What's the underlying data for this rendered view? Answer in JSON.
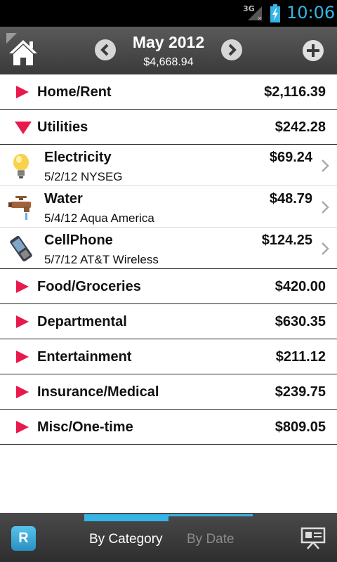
{
  "status_bar": {
    "network": "3G",
    "time": "10:06",
    "battery_icon": "battery-charging-icon",
    "signal_icon": "signal-no-data-icon",
    "time_color": "#33b5e5"
  },
  "header": {
    "title": "May 2012",
    "total": "$4,668.94",
    "home_icon": "home-icon",
    "prev_icon": "chevron-left-icon",
    "next_icon": "chevron-right-icon",
    "add_icon": "plus-icon"
  },
  "categories": [
    {
      "name": "Home/Rent",
      "amount": "$2,116.39",
      "expanded": false
    },
    {
      "name": "Utilities",
      "amount": "$242.28",
      "expanded": true,
      "items": [
        {
          "name": "Electricity",
          "detail": "5/2/12 NYSEG",
          "amount": "$69.24",
          "icon": "lightbulb-icon"
        },
        {
          "name": "Water",
          "detail": "5/4/12 Aqua America",
          "amount": "$48.79",
          "icon": "faucet-icon"
        },
        {
          "name": "CellPhone",
          "detail": "5/7/12 AT&T Wireless",
          "amount": "$124.25",
          "icon": "cellphone-icon"
        }
      ]
    },
    {
      "name": "Food/Groceries",
      "amount": "$420.00",
      "expanded": false
    },
    {
      "name": "Departmental",
      "amount": "$630.35",
      "expanded": false
    },
    {
      "name": "Entertainment",
      "amount": "$211.12",
      "expanded": false
    },
    {
      "name": "Insurance/Medical",
      "amount": "$239.75",
      "expanded": false
    },
    {
      "name": "Misc/One-time",
      "amount": "$809.05",
      "expanded": false
    }
  ],
  "bottom_bar": {
    "app_icon_letter": "R",
    "tabs": [
      {
        "label": "By Category",
        "selected": true
      },
      {
        "label": "By Date",
        "selected": false
      }
    ],
    "presenter_icon": "presentation-icon"
  },
  "colors": {
    "accent": "#e8194b",
    "tab_accent": "#33b5e5",
    "header_bg": "#4a4a4a"
  }
}
